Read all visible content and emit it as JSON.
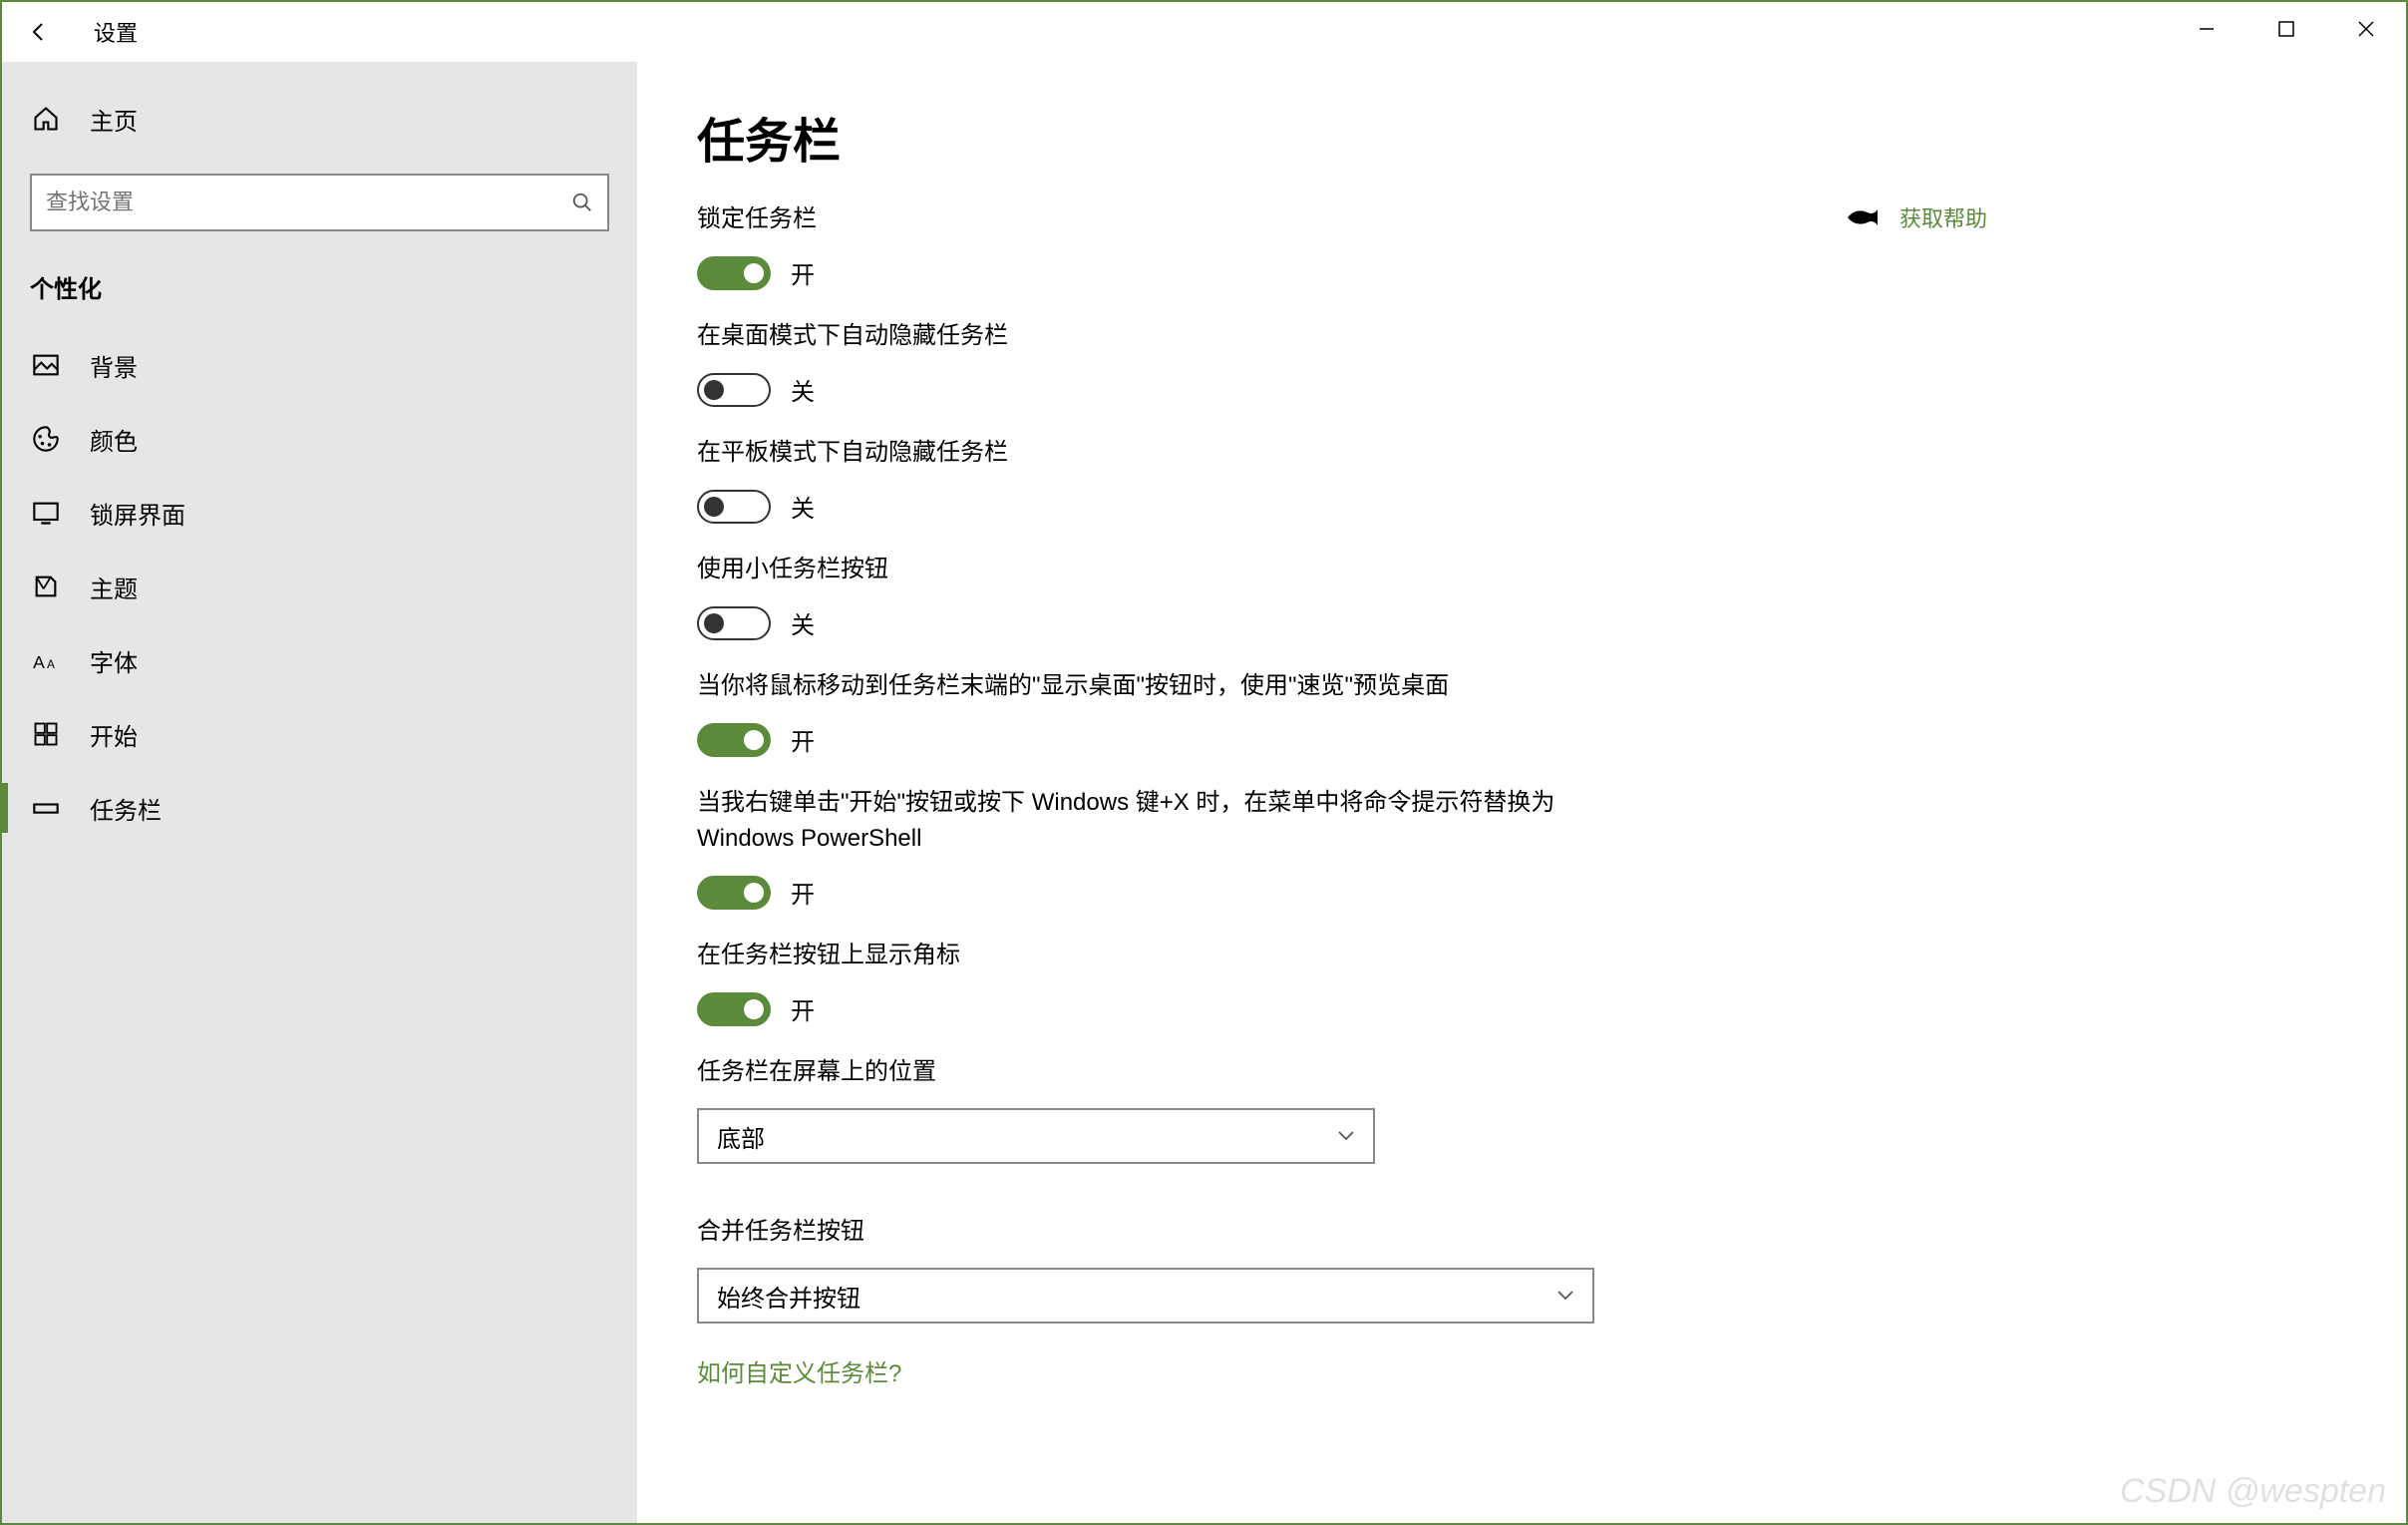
{
  "titlebar": {
    "title": "设置"
  },
  "sidebar": {
    "home": "主页",
    "search_placeholder": "查找设置",
    "section": "个性化",
    "items": [
      {
        "label": "背景"
      },
      {
        "label": "颜色"
      },
      {
        "label": "锁屏界面"
      },
      {
        "label": "主题"
      },
      {
        "label": "字体"
      },
      {
        "label": "开始"
      },
      {
        "label": "任务栏"
      }
    ]
  },
  "content": {
    "heading": "任务栏",
    "settings": [
      {
        "label": "锁定任务栏",
        "on": true,
        "state": "开"
      },
      {
        "label": "在桌面模式下自动隐藏任务栏",
        "on": false,
        "state": "关"
      },
      {
        "label": "在平板模式下自动隐藏任务栏",
        "on": false,
        "state": "关"
      },
      {
        "label": "使用小任务栏按钮",
        "on": false,
        "state": "关"
      },
      {
        "label": "当你将鼠标移动到任务栏末端的\"显示桌面\"按钮时，使用\"速览\"预览桌面",
        "on": true,
        "state": "开"
      },
      {
        "label": "当我右键单击\"开始\"按钮或按下 Windows 键+X 时，在菜单中将命令提示符替换为 Windows PowerShell",
        "on": true,
        "state": "开"
      },
      {
        "label": "在任务栏按钮上显示角标",
        "on": true,
        "state": "开"
      }
    ],
    "position_label": "任务栏在屏幕上的位置",
    "position_value": "底部",
    "combine_label": "合并任务栏按钮",
    "combine_value": "始终合并按钮",
    "how_link": "如何自定义任务栏?",
    "help_text": "获取帮助"
  },
  "watermark": "CSDN @wespten"
}
